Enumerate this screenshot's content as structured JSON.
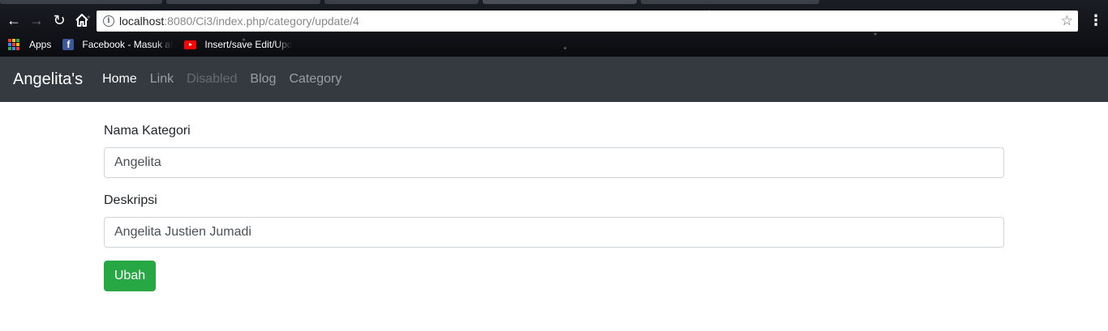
{
  "browser": {
    "url_host": "localhost",
    "url_path": ":8080/Ci3/index.php/category/update/4",
    "bookmarks": [
      {
        "label": "Apps",
        "icon": "apps-grid-icon"
      },
      {
        "label": "Facebook - Masuk at",
        "icon": "facebook-icon"
      },
      {
        "label": "Insert/save Edit/Upd",
        "icon": "youtube-icon"
      }
    ],
    "apps_grid_colors": [
      "#ea4335",
      "#fbbc05",
      "#34a853",
      "#4285f4",
      "#ea4335",
      "#fbbc05",
      "#34a853",
      "#4285f4",
      "#ea4335"
    ],
    "icons": {
      "back": "back-arrow-icon",
      "forward": "forward-arrow-icon",
      "reload": "reload-icon",
      "home": "home-icon",
      "info": "info-icon",
      "star": "star-icon",
      "menu": "menu-dots-icon"
    }
  },
  "navbar": {
    "brand": "Angelita's",
    "links": [
      {
        "label": "Home",
        "state": "active"
      },
      {
        "label": "Link",
        "state": "normal"
      },
      {
        "label": "Disabled",
        "state": "disabled"
      },
      {
        "label": "Blog",
        "state": "normal"
      },
      {
        "label": "Category",
        "state": "normal"
      }
    ],
    "background": "#343a40"
  },
  "form": {
    "nama_label": "Nama Kategori",
    "nama_value": "Angelita",
    "deskripsi_label": "Deskripsi",
    "deskripsi_value": "Angelita Justien Jumadi",
    "submit_label": "Ubah",
    "submit_color": "#28a745"
  }
}
